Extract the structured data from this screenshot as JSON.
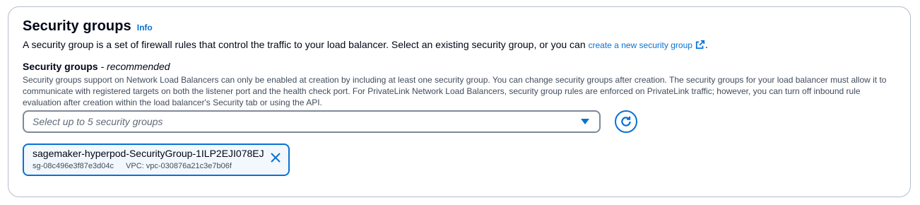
{
  "section": {
    "title": "Security groups",
    "info_label": "Info",
    "description": "A security group is a set of firewall rules that control the traffic to your load balancer. Select an existing security group, or you can",
    "create_link": "create a new security group",
    "description_end": "."
  },
  "field": {
    "label": "Security groups",
    "label_suffix": "- recommended",
    "description": "Security groups support on Network Load Balancers can only be enabled at creation by including at least one security group. You can change security groups after creation. The security groups for your load balancer must allow it to communicate with registered targets on both the listener port and the health check port. For PrivateLink Network Load Balancers, security group rules are enforced on PrivateLink traffic; however, you can turn off inbound rule evaluation after creation within the load balancer's Security tab or using the API."
  },
  "select": {
    "placeholder": "Select up to 5 security groups"
  },
  "token": {
    "name": "sagemaker-hyperpod-SecurityGroup-1ILP2EJI078EJ",
    "id": "sg-08c496e3f87e3d04c",
    "vpc": "VPC: vpc-030876a21c3e7b06f"
  },
  "colors": {
    "accent": "#0972d3",
    "text": "#000716",
    "border": "#7d8998"
  },
  "icons": [
    "external-link-icon",
    "caret-down-icon",
    "refresh-icon",
    "close-icon"
  ]
}
